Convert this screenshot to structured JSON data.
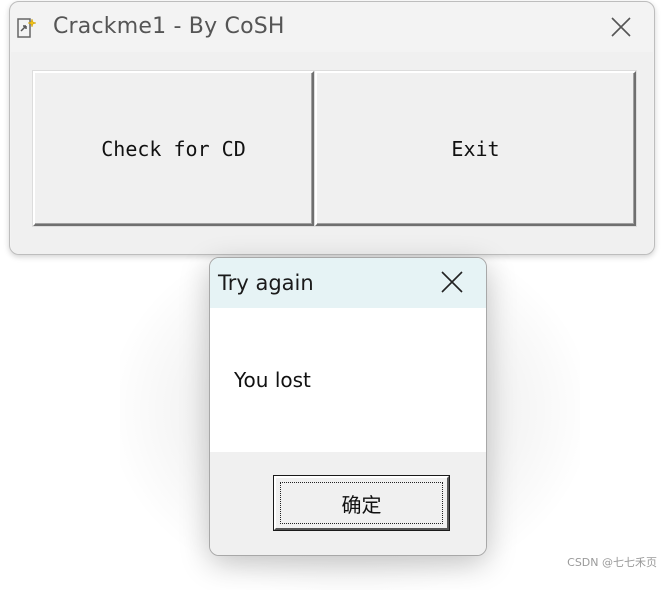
{
  "main_window": {
    "title": "Crackme1 - By CoSH",
    "buttons": {
      "check": "Check for CD",
      "exit": "Exit"
    }
  },
  "dialog": {
    "title": "Try again",
    "message": "You lost",
    "ok_label": "确定"
  },
  "watermark": "CSDN @七七禾页",
  "icons": {
    "app": "app-document-icon",
    "close": "close-icon"
  },
  "colors": {
    "window_bg": "#f0f0f0",
    "dialog_title_bg": "#e6f3f5",
    "title_text": "#555555"
  }
}
